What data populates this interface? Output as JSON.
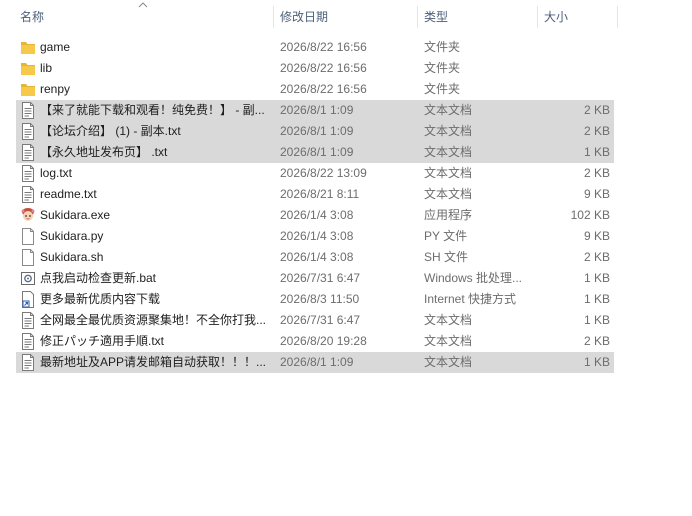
{
  "columns": {
    "name": "名称",
    "date": "修改日期",
    "type": "类型",
    "size": "大小"
  },
  "colors": {
    "header_text": "#4c607a",
    "selected_row": "#d9d9d9",
    "folder": "#f7c948",
    "detail_text": "#6d6d6d"
  },
  "files": [
    {
      "name": "game",
      "date": "2026/8/22 16:56",
      "type": "文件夹",
      "size": "",
      "icon": "folder-icon",
      "selected": false
    },
    {
      "name": "lib",
      "date": "2026/8/22 16:56",
      "type": "文件夹",
      "size": "",
      "icon": "folder-icon",
      "selected": false
    },
    {
      "name": "renpy",
      "date": "2026/8/22 16:56",
      "type": "文件夹",
      "size": "",
      "icon": "folder-icon",
      "selected": false
    },
    {
      "name": "【来了就能下载和观看！纯免费！】 - 副...",
      "date": "2026/8/1 1:09",
      "type": "文本文档",
      "size": "2 KB",
      "icon": "text-file-icon",
      "selected": true
    },
    {
      "name": "【论坛介绍】 (1) - 副本.txt",
      "date": "2026/8/1 1:09",
      "type": "文本文档",
      "size": "2 KB",
      "icon": "text-file-icon",
      "selected": true
    },
    {
      "name": "【永久地址发布页】 .txt",
      "date": "2026/8/1 1:09",
      "type": "文本文档",
      "size": "1 KB",
      "icon": "text-file-icon",
      "selected": true
    },
    {
      "name": "log.txt",
      "date": "2026/8/22 13:09",
      "type": "文本文档",
      "size": "2 KB",
      "icon": "text-file-icon",
      "selected": false
    },
    {
      "name": "readme.txt",
      "date": "2026/8/21 8:11",
      "type": "文本文档",
      "size": "9 KB",
      "icon": "text-file-icon",
      "selected": false
    },
    {
      "name": "Sukidara.exe",
      "date": "2026/1/4 3:08",
      "type": "应用程序",
      "size": "102 KB",
      "icon": "app-icon",
      "selected": false
    },
    {
      "name": "Sukidara.py",
      "date": "2026/1/4 3:08",
      "type": "PY 文件",
      "size": "9 KB",
      "icon": "blank-file-icon",
      "selected": false
    },
    {
      "name": "Sukidara.sh",
      "date": "2026/1/4 3:08",
      "type": "SH 文件",
      "size": "2 KB",
      "icon": "blank-file-icon",
      "selected": false
    },
    {
      "name": "点我启动检查更新.bat",
      "date": "2026/7/31 6:47",
      "type": "Windows 批处理...",
      "size": "1 KB",
      "icon": "batch-file-icon",
      "selected": false
    },
    {
      "name": "更多最新优质内容下载",
      "date": "2026/8/3 11:50",
      "type": "Internet 快捷方式",
      "size": "1 KB",
      "icon": "shortcut-icon",
      "selected": false
    },
    {
      "name": "全网最全最优质资源聚集地！不全你打我...",
      "date": "2026/7/31 6:47",
      "type": "文本文档",
      "size": "1 KB",
      "icon": "text-file-icon",
      "selected": false
    },
    {
      "name": "修正パッチ適用手順.txt",
      "date": "2026/8/20 19:28",
      "type": "文本文档",
      "size": "2 KB",
      "icon": "text-file-icon",
      "selected": false
    },
    {
      "name": "最新地址及APP请发邮箱自动获取！！！...",
      "date": "2026/8/1 1:09",
      "type": "文本文档",
      "size": "1 KB",
      "icon": "text-file-icon",
      "selected": true
    }
  ]
}
